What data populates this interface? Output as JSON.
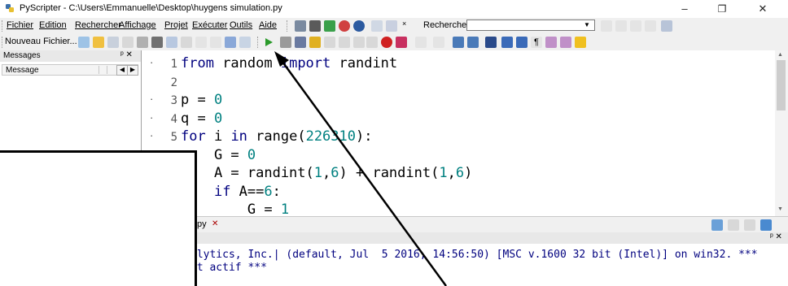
{
  "window": {
    "title": "PyScripter - C:\\Users\\Emmanuelle\\Desktop\\huygens simulation.py",
    "minimize_glyph": "–",
    "restore_glyph": "❐",
    "close_glyph": "✕"
  },
  "menu": [
    "Fichier",
    "Edition",
    "Rechercher",
    "Affichage",
    "Projet",
    "Exécuter",
    "Outils",
    "Aide"
  ],
  "search": {
    "label": "Rechercher:",
    "value": ""
  },
  "toolbar": {
    "new_file_label": "Nouveau Fichier..."
  },
  "messages_panel": {
    "title": "Messages",
    "pin": "ᵖ ✕",
    "column": "Message"
  },
  "editor": {
    "lines": [
      {
        "n": "1",
        "marker": "·",
        "html": "<span class=\"kw\">from</span> random <span class=\"kw\">import</span> randint"
      },
      {
        "n": "2",
        "marker": "",
        "html": ""
      },
      {
        "n": "3",
        "marker": "·",
        "html": "p = <span class=\"num\">0</span>"
      },
      {
        "n": "4",
        "marker": "·",
        "html": "q = <span class=\"num\">0</span>"
      },
      {
        "n": "5",
        "marker": "·",
        "html": "<span class=\"kw\">for</span> i <span class=\"kw\">in</span> range(<span class=\"num\">226310</span>):"
      },
      {
        "n": "6",
        "marker": "",
        "html": "    G = <span class=\"num\">0</span>"
      },
      {
        "n": "7",
        "marker": "",
        "html": "    A = randint(<span class=\"num\">1</span>,<span class=\"num\">6</span>) + randint(<span class=\"num\">1</span>,<span class=\"num\">6</span>)"
      },
      {
        "n": "8",
        "marker": "",
        "html": "    <span class=\"kw\">if</span> A==<span class=\"num\">6</span>:"
      },
      {
        "n": "9",
        "marker": "",
        "html": "        G = <span class=\"num\">1</span>"
      }
    ]
  },
  "tab": {
    "label": "py",
    "close": "✕"
  },
  "console": {
    "pin": "ᵖ ✕",
    "lines": [
      "alytics, Inc.| (default, Jul  5 2016, 14:56:50) [MSC v.1600 32 bit (Intel)] on win32. ***",
      "st actif ***"
    ]
  },
  "colors": {
    "keyword": "#00007f",
    "number": "#008080"
  },
  "icons": [
    "python-logo-icon",
    "run-icon",
    "debug-icon",
    "search-icon",
    "new-file-icon"
  ]
}
